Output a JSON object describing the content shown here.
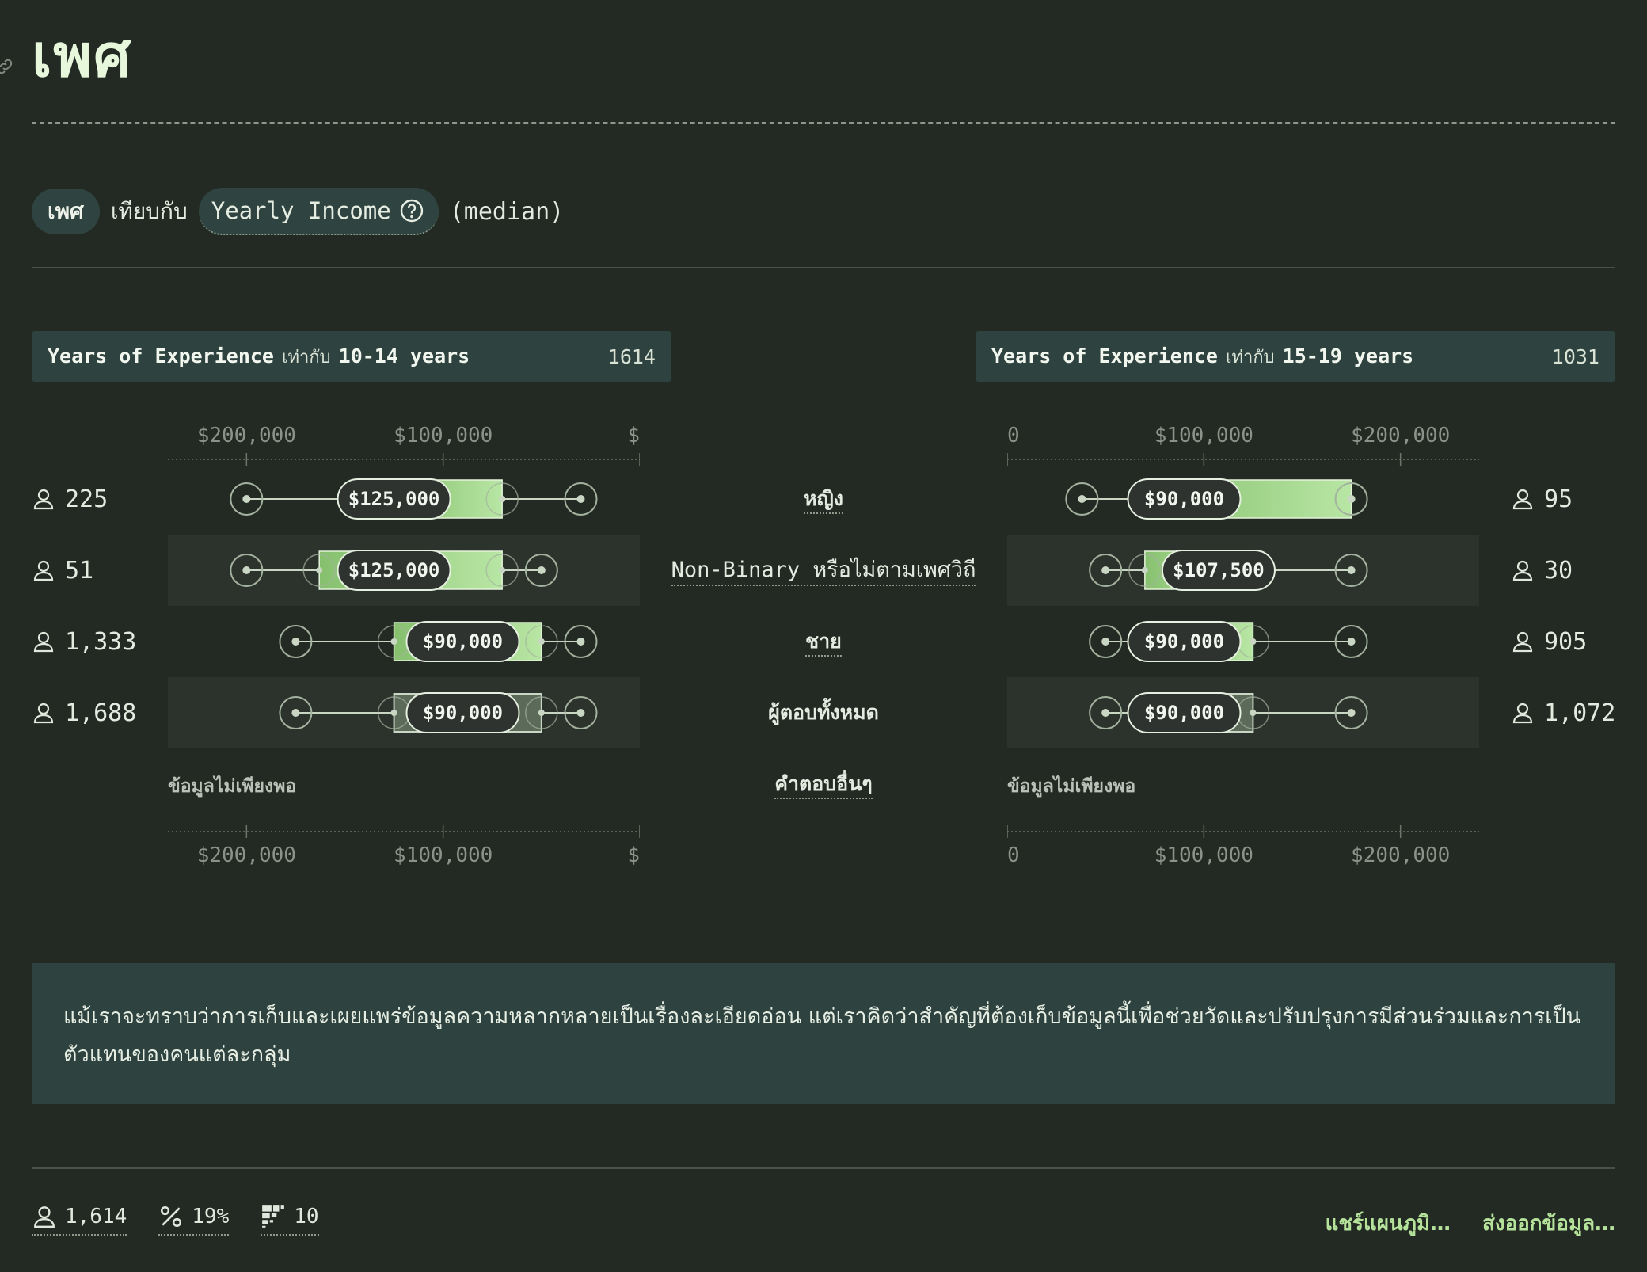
{
  "title": "เพศ",
  "selector": {
    "group": "เพศ",
    "vs": "เทียบกับ",
    "variable": "Yearly Income",
    "stat": "(median)"
  },
  "callout": "แม้เราจะทราบว่าการเก็บและเผยแพร่ข้อมูลความหลากหลายเป็นเรื่องละเอียดอ่อน แต่เราคิดว่าสำคัญที่ต้องเก็บข้อมูลนี้เพื่อช่วยวัดและปรับปรุงการมีส่วนร่วมและการเป็นตัวแทนของคนแต่ละกลุ่ม",
  "footer": {
    "respondents": "1,614",
    "percent": "19%",
    "buckets": "10",
    "share": "แชร์แผนภูมิ…",
    "export": "ส่งออกข้อมูล…"
  },
  "colors": {
    "background": "#232a23",
    "bar_light": "#b8e6a4",
    "bar_dark": "#86c06e",
    "label_bg": "#2f3330"
  },
  "chart_data": [
    {
      "type": "boxplot",
      "facet_variable": "Years of Experience",
      "facet_operator": "เท่ากับ",
      "facet_value": "10-14 years",
      "facet_total": "1614",
      "x_direction": "reversed",
      "xlim": [
        240000,
        0
      ],
      "ticks": [
        "$200,000",
        "$100,000",
        "$0"
      ],
      "tick_values": [
        200000,
        100000,
        0
      ],
      "categories": [
        "หญิง",
        "Non-Binary หรือไม่ตามเพศวิถี",
        "ชาย",
        "ผู้ตอบทั้งหมด"
      ],
      "counts": [
        "225",
        "51",
        "1,333",
        "1,688"
      ],
      "median_labels": [
        "$125,000",
        "$125,000",
        "$90,000",
        "$90,000"
      ],
      "series": [
        {
          "p10": 200000,
          "p25": 125000,
          "median": 125000,
          "p75": 70000,
          "p90": 30000,
          "highlight": false
        },
        {
          "p10": 200000,
          "p25": 163000,
          "median": 125000,
          "p75": 70000,
          "p90": 50000,
          "highlight": false
        },
        {
          "p10": 175000,
          "p25": 125000,
          "median": 90000,
          "p75": 50000,
          "p90": 30000,
          "highlight": false
        },
        {
          "p10": 175000,
          "p25": 125000,
          "median": 90000,
          "p75": 50000,
          "p90": 30000,
          "highlight": true
        }
      ],
      "insufficient": "ข้อมูลไม่เพียงพอ"
    },
    {
      "type": "boxplot",
      "facet_variable": "Years of Experience",
      "facet_operator": "เท่ากับ",
      "facet_value": "15-19 years",
      "facet_total": "1031",
      "x_direction": "normal",
      "xlim": [
        0,
        240000
      ],
      "ticks": [
        "$0",
        "$100,000",
        "$200,000"
      ],
      "tick_values": [
        0,
        100000,
        200000
      ],
      "categories": [
        "หญิง",
        "Non-Binary หรือไม่ตามเพศวิถี",
        "ชาย",
        "ผู้ตอบทั้งหมด"
      ],
      "counts": [
        "95",
        "30",
        "905",
        "1,072"
      ],
      "median_labels": [
        "$90,000",
        "$107,500",
        "$90,000",
        "$90,000"
      ],
      "series": [
        {
          "p10": 38000,
          "p25": 70000,
          "median": 90000,
          "p75": 175000,
          "p90": 175000,
          "highlight": false
        },
        {
          "p10": 50000,
          "p25": 70000,
          "median": 107500,
          "p75": 107500,
          "p90": 175000,
          "highlight": false
        },
        {
          "p10": 50000,
          "p25": 70000,
          "median": 90000,
          "p75": 125000,
          "p90": 175000,
          "highlight": false
        },
        {
          "p10": 50000,
          "p25": 70000,
          "median": 90000,
          "p75": 125000,
          "p90": 175000,
          "highlight": true
        }
      ],
      "insufficient": "ข้อมูลไม่เพียงพอ"
    }
  ],
  "other_category": "คำตอบอื่นๆ"
}
